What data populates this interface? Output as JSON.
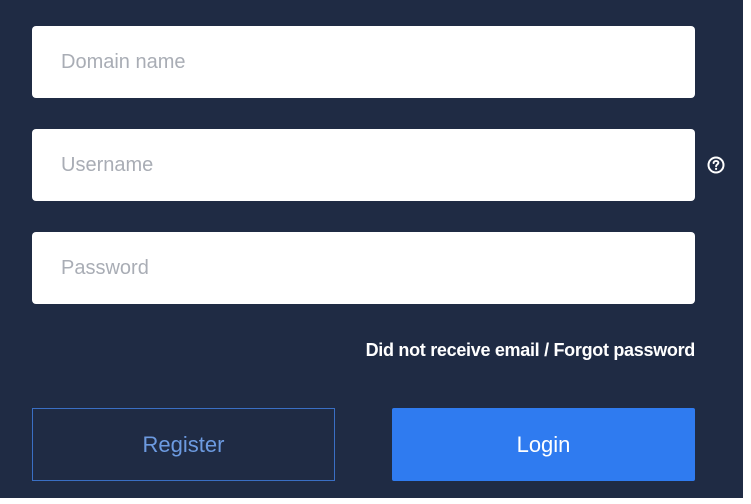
{
  "form": {
    "domain": {
      "placeholder": "Domain name",
      "value": ""
    },
    "username": {
      "placeholder": "Username",
      "value": ""
    },
    "password": {
      "placeholder": "Password",
      "value": ""
    }
  },
  "links": {
    "email_forgot": "Did not receive email / Forgot password"
  },
  "buttons": {
    "register": "Register",
    "login": "Login"
  },
  "icons": {
    "help": "question-circle-icon"
  },
  "colors": {
    "background": "#1f2b44",
    "primary": "#2f7bf0",
    "register_text": "#6c9ae0",
    "register_border": "#3a6fc4"
  }
}
